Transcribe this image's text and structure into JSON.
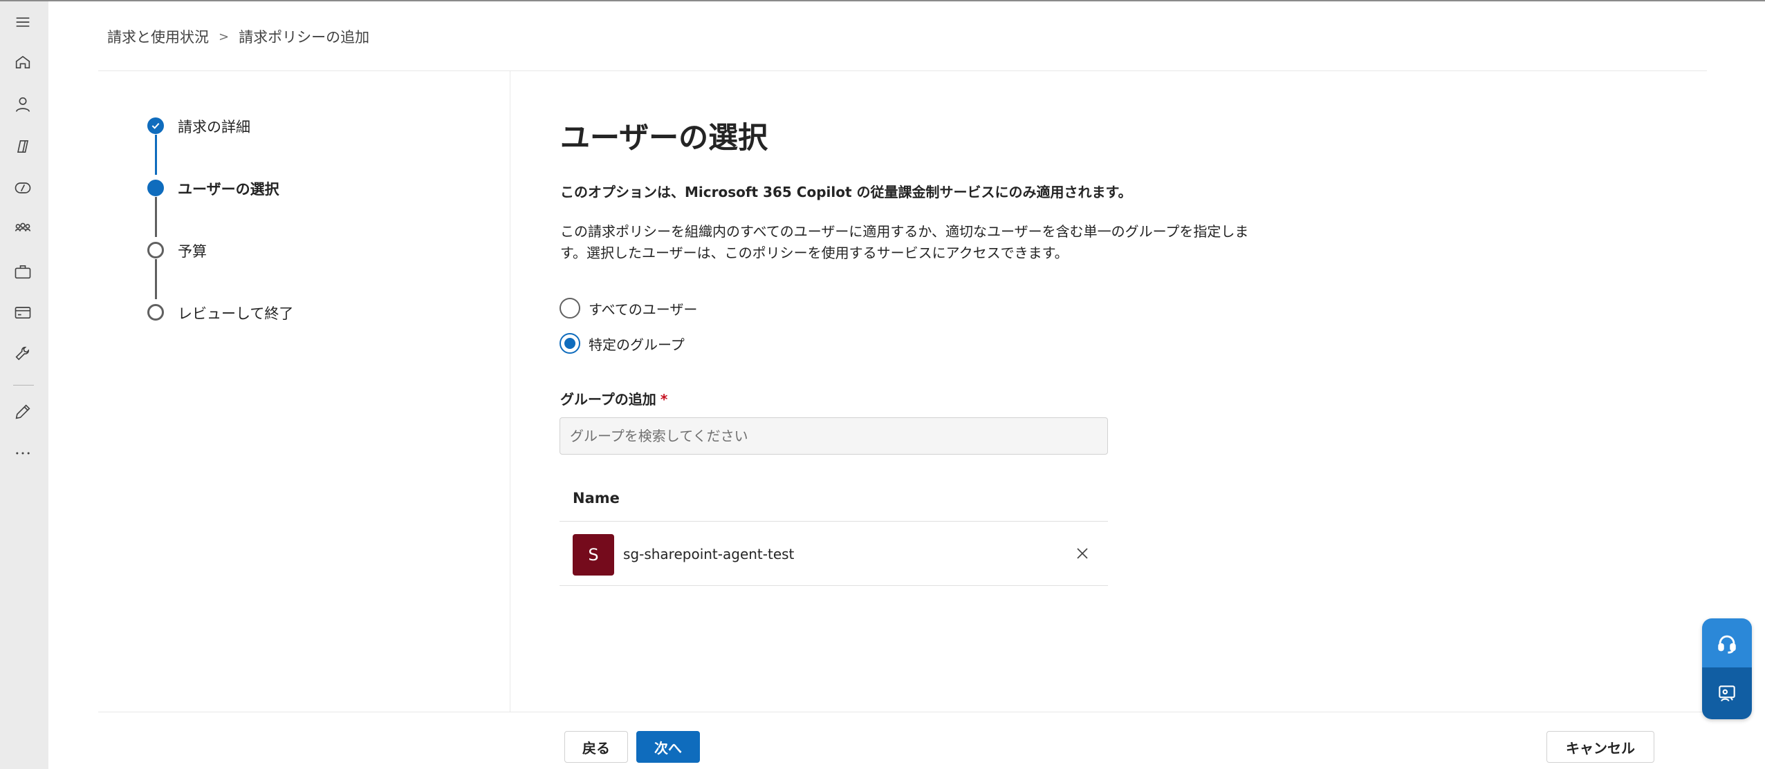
{
  "breadcrumb": {
    "root": "請求と使用状況",
    "current": "請求ポリシーの追加"
  },
  "rail": {
    "icons": [
      "menu-icon",
      "home-icon",
      "user-icon",
      "copilot-icon",
      "agents-icon",
      "teams-icon",
      "briefcase-icon",
      "billing-card-icon",
      "wrench-icon",
      "pencil-icon",
      "more-icon"
    ]
  },
  "stepper": {
    "steps": [
      {
        "label": "請求の詳細",
        "state": "done"
      },
      {
        "label": "ユーザーの選択",
        "state": "current"
      },
      {
        "label": "予算",
        "state": "todo"
      },
      {
        "label": "レビューして終了",
        "state": "todo"
      }
    ]
  },
  "main": {
    "title": "ユーザーの選択",
    "notice": "このオプションは、Microsoft 365 Copilot の従量課金制サービスにのみ適用されます。",
    "description": "この請求ポリシーを組織内のすべてのユーザーに適用するか、適切なユーザーを含む単一のグループを指定します。選択したユーザーは、このポリシーを使用するサービスにアクセスできます。",
    "radio_all": "すべてのユーザー",
    "radio_group": "特定のグループ",
    "selected_option": "group",
    "group_label": "グループの追加",
    "required_mark": "*",
    "search_placeholder": "グループを検索してください",
    "search_value": "",
    "table_header": "Name",
    "rows": [
      {
        "initial": "S",
        "name": "sg-sharepoint-agent-test",
        "avatar_color": "#750b1c"
      }
    ]
  },
  "footer": {
    "back": "戻る",
    "next": "次へ",
    "cancel": "キャンセル"
  },
  "colors": {
    "accent": "#0f6cbd",
    "help_top": "#2b88d8",
    "help_bottom": "#115ea3"
  }
}
